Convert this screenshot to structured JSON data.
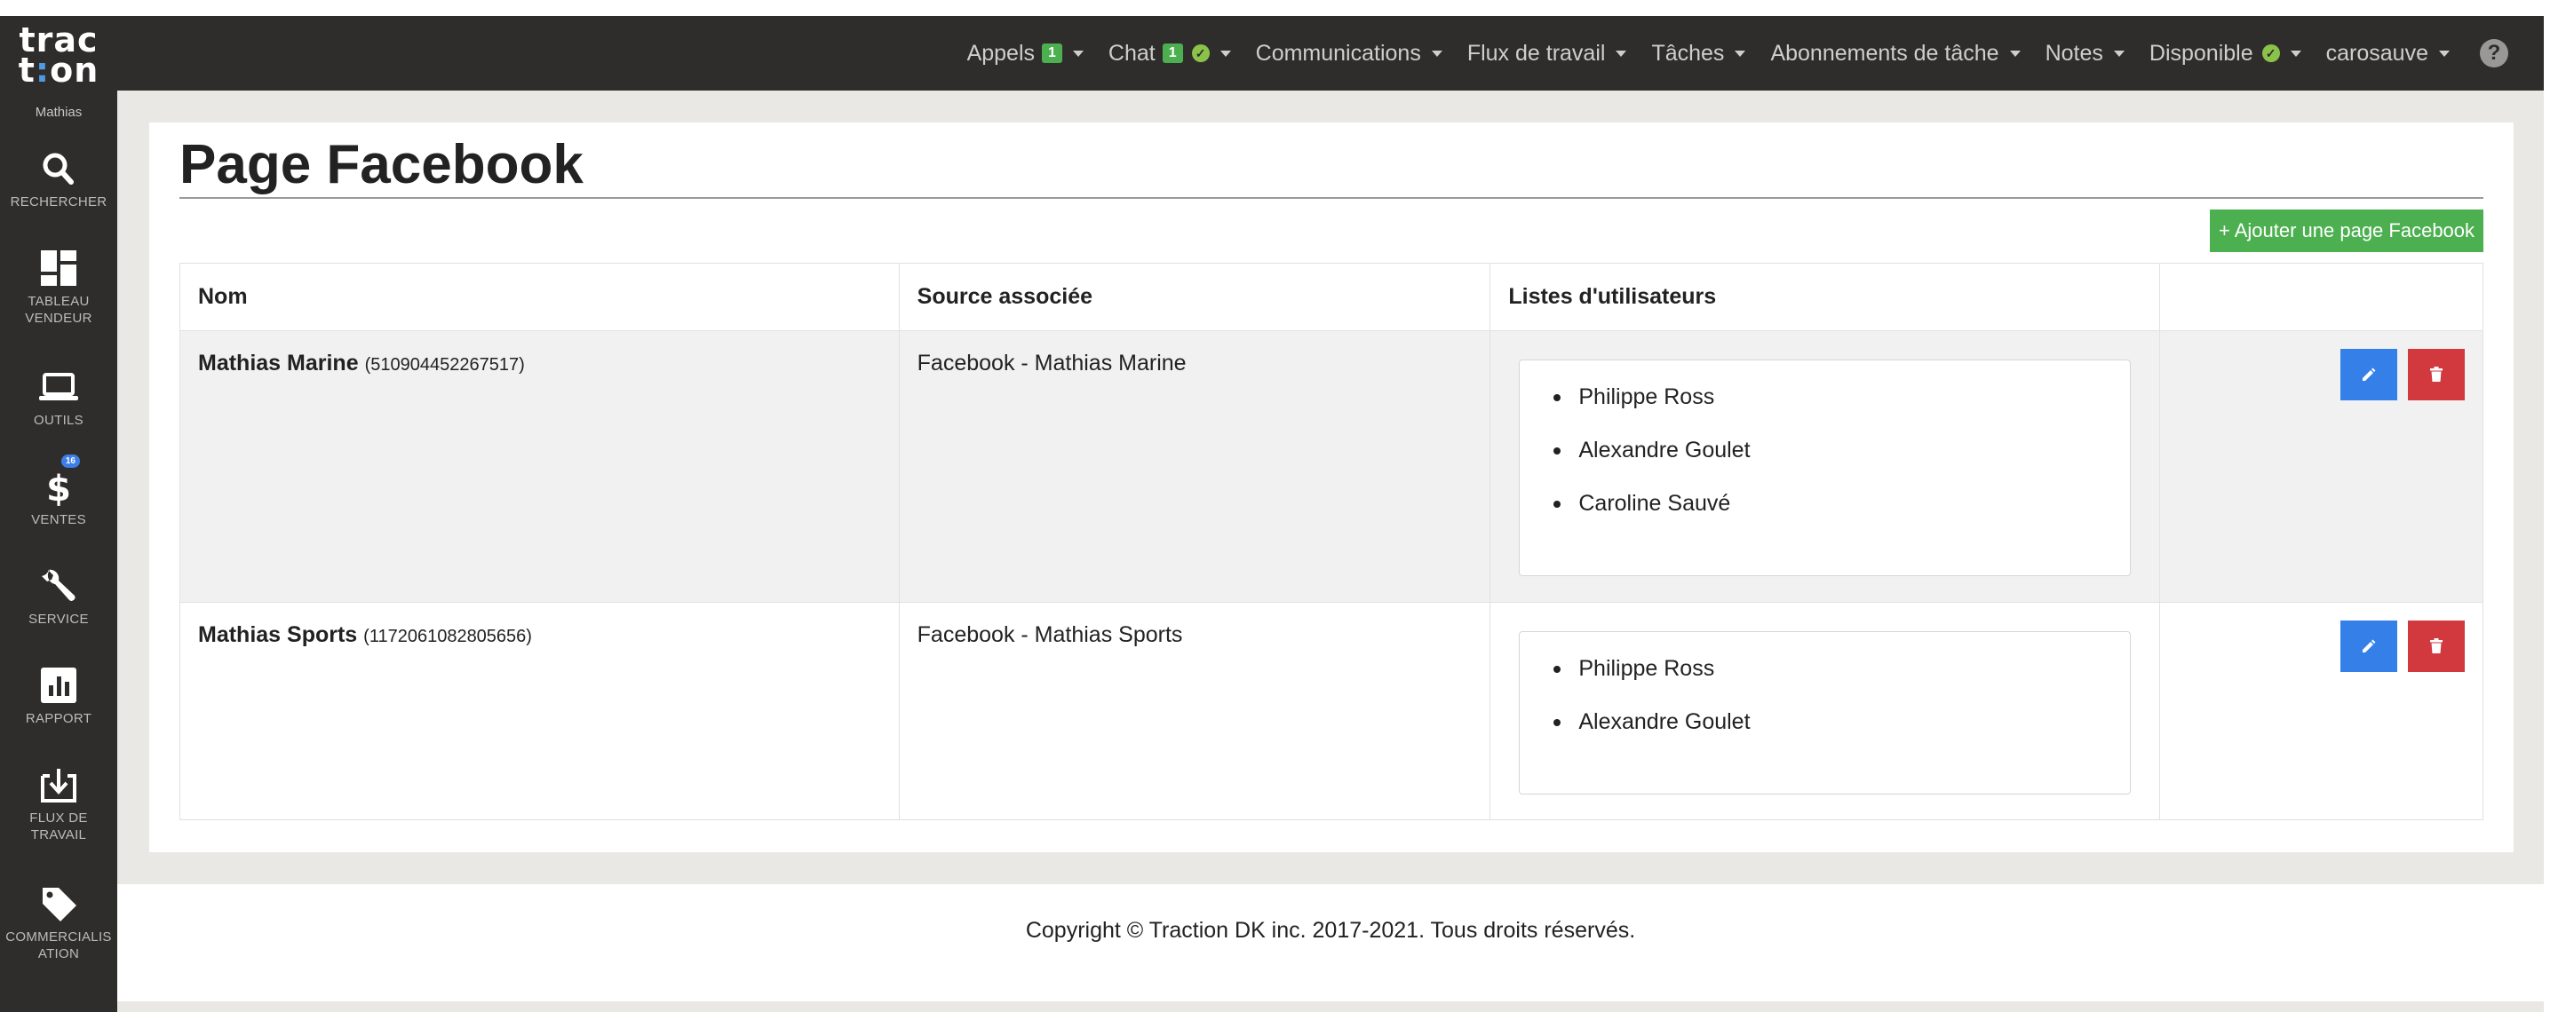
{
  "app": {
    "logo_line1": "trac",
    "logo_line2a": "t",
    "logo_line2b": ":",
    "logo_line2c": "on",
    "user": "Mathias"
  },
  "sidebar": {
    "items": [
      {
        "label": "RECHERCHER",
        "icon": "search-icon"
      },
      {
        "label": "TABLEAU VENDEUR",
        "icon": "dashboard-icon"
      },
      {
        "label": "OUTILS",
        "icon": "laptop-icon"
      },
      {
        "label": "VENTES",
        "icon": "dollar-icon",
        "badge": "16"
      },
      {
        "label": "SERVICE",
        "icon": "wrench-icon"
      },
      {
        "label": "RAPPORT",
        "icon": "bar-chart-icon"
      },
      {
        "label": "FLUX DE TRAVAIL",
        "icon": "download-icon"
      },
      {
        "label": "COMMERCIALISATION",
        "icon": "tag-icon"
      }
    ]
  },
  "navbar": {
    "calls": "Appels",
    "calls_badge": "1",
    "chat": "Chat",
    "chat_badge": "1",
    "communications": "Communications",
    "workflow": "Flux de travail",
    "tasks": "Tâches",
    "task_subscriptions": "Abonnements de tâche",
    "notes": "Notes",
    "status": "Disponible",
    "user": "carosauve",
    "help": "?"
  },
  "page": {
    "title": "Page Facebook",
    "add_button": "+ Ajouter une page Facebook"
  },
  "table": {
    "headers": [
      "Nom",
      "Source associée",
      "Listes d'utilisateurs",
      ""
    ],
    "rows": [
      {
        "name": "Mathias Marine",
        "page_id": "(510904452267517)",
        "source": "Facebook - Mathias Marine",
        "users": [
          "Philippe Ross",
          "Alexandre Goulet",
          "Caroline Sauvé"
        ]
      },
      {
        "name": "Mathias Sports",
        "page_id": "(1172061082805656)",
        "source": "Facebook - Mathias Sports",
        "users": [
          "Philippe Ross",
          "Alexandre Goulet"
        ]
      }
    ]
  },
  "footer": {
    "copyright": "Copyright © Traction DK inc. 2017-2021. Tous droits réservés."
  },
  "colors": {
    "dark_bar": "#2f2d2b",
    "success": "#4caf50",
    "primary": "#3480e8",
    "danger": "#d2393f",
    "content_bg": "#e9e8e4"
  }
}
